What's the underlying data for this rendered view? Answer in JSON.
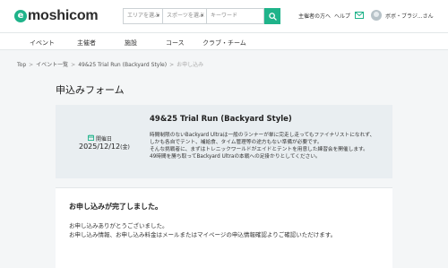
{
  "header": {
    "logo_mark": "e",
    "logo_text": "moshicom",
    "search": {
      "area_placeholder": "エリアを選ぶ",
      "sport_placeholder": "スポーツを選ぶ",
      "keyword_placeholder": "キーワード"
    },
    "organizer_link": "主催者の方へ",
    "help_link": "ヘルプ",
    "user_name": "ボボ・ブラジ...さん"
  },
  "nav": {
    "items": [
      "イベント",
      "主催者",
      "施設",
      "コース",
      "クラブ・チーム"
    ]
  },
  "breadcrumb": {
    "items": [
      "Top",
      "イベント一覧",
      "49&25 Trial Run (Backyard Style)"
    ],
    "current": "お申し込み"
  },
  "page_title": "申込みフォーム",
  "event": {
    "date_label": "開催日",
    "date": "2025/12/12",
    "day_of_week": "(金)",
    "title": "49&25 Trial Run (Backyard Style)",
    "description": [
      "時間制限のないBackyard Ultraは一般のランナーが単に完走し走ってもファイナリストになれず、",
      "しかも各自でテント、補給食、タイム管理等の途方もない準備が必要です。",
      "そんな挑戦者に、まずはトレニックワールドがエイドとテントを用意した練習会を開催します。",
      "49時間を勝ち取ってBackyard Ultraの本戦への足掛かりとしてください。"
    ]
  },
  "completion": {
    "title": "お申し込みが完了しました。",
    "messages": [
      "お申し込みありがとうございました。",
      "お申し込み情報、お申し込み料金はメールまたはマイページの申込情報確認よりご確認いただけます。"
    ]
  },
  "colors": {
    "brand": "#1fb38a",
    "card_bg": "#e9eef1",
    "page_bg": "#f4f6f7"
  },
  "icons": {
    "search": "search-icon",
    "mail": "mail-icon",
    "calendar": "calendar-icon",
    "avatar": "avatar"
  }
}
